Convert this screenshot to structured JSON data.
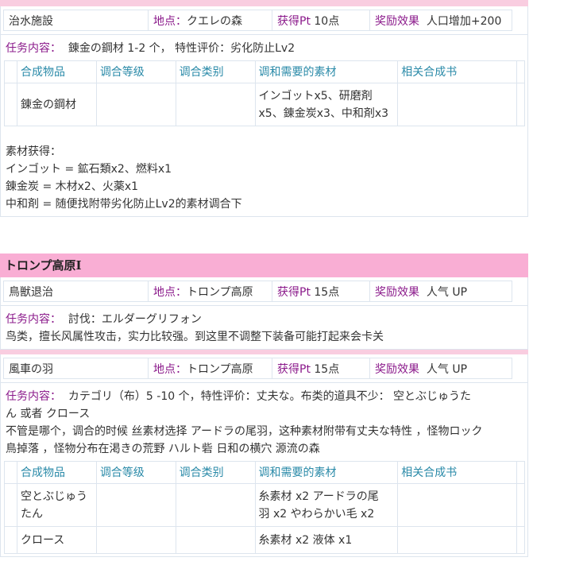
{
  "sec1": {
    "info": {
      "name": "治水施設",
      "location_label": "地点：",
      "location": "クエレの森",
      "pt_label": "获得Pt",
      "pt": "10点",
      "reward_label": "奖励效果",
      "reward": "人口增加+200"
    },
    "task_label": "任务内容：",
    "task_text": "錬金の鋼材 1-2 个， 特性评价：劣化防止Lv2",
    "table": {
      "headers": [
        "合成物品",
        "调合等级",
        "调合类别",
        "调和需要的素材",
        "相关合成书"
      ],
      "rows": [
        {
          "item_line1": "錬金の鋼材",
          "item_line2": "",
          "level": "",
          "category": "",
          "mat_line1": "インゴットx5、研磨剤",
          "mat_line2": "x5、錬金炭x3、中和剤x3",
          "book": ""
        }
      ]
    },
    "notes": [
      "素材获得：",
      "インゴット = 鉱石類x2、燃料x1",
      "錬金炭 = 木材x2、火薬x1",
      "中和剤 = 随便找附带劣化防止Lv2的素材调合下"
    ]
  },
  "sec2": {
    "title": "トロンプ高原I",
    "quest1": {
      "info": {
        "name": "鳥獣退治",
        "location_label": "地点：",
        "location": "トロンプ高原",
        "pt_label": "获得Pt",
        "pt": "15点",
        "reward_label": "奖励效果",
        "reward": "人气 UP"
      },
      "task_label": "任务内容：",
      "task_text": "討伐：エルダーグリフォン",
      "note": "鸟类，擅长风属性攻击，实力比较强。到这里不调整下装备可能打起来会卡关"
    },
    "quest2": {
      "info": {
        "name": "風車の羽",
        "location_label": "地点：",
        "location": "トロンプ高原",
        "pt_label": "获得Pt",
        "pt": "15点",
        "reward_label": "奖励效果",
        "reward": "人气 UP"
      },
      "task_label": "任务内容：",
      "task_line1": "カテゴリ（布）5 -10 个，特性评价：丈夫な。布类的道具不少： 空とぶじゅうた",
      "task_line2": "ん 或者 クロース",
      "note_line1": "不管是哪个，调合的时候 丝素材选择 アードラの尾羽，这种素材附带有丈夫な特性 ，怪物ロック",
      "note_line2": "鳥掉落 ，怪物分布在渇きの荒野 ハルト砦 日和の横穴 源流の森",
      "table": {
        "headers": [
          "合成物品",
          "调合等级",
          "调合类别",
          "调和需要的素材",
          "相关合成书"
        ],
        "rows": [
          {
            "item_line1": "空とぶじゅう",
            "item_line2": "たん",
            "level": "",
            "category": "",
            "mat_line1": "糸素材 x2 アードラの尾",
            "mat_line2": "羽 x2 やわらかい毛 x2",
            "book": ""
          },
          {
            "item_line1": "クロース",
            "item_line2": "",
            "level": "",
            "category": "",
            "mat_line1": "糸素材 x2 液体 x1",
            "mat_line2": "",
            "book": ""
          }
        ]
      }
    }
  }
}
